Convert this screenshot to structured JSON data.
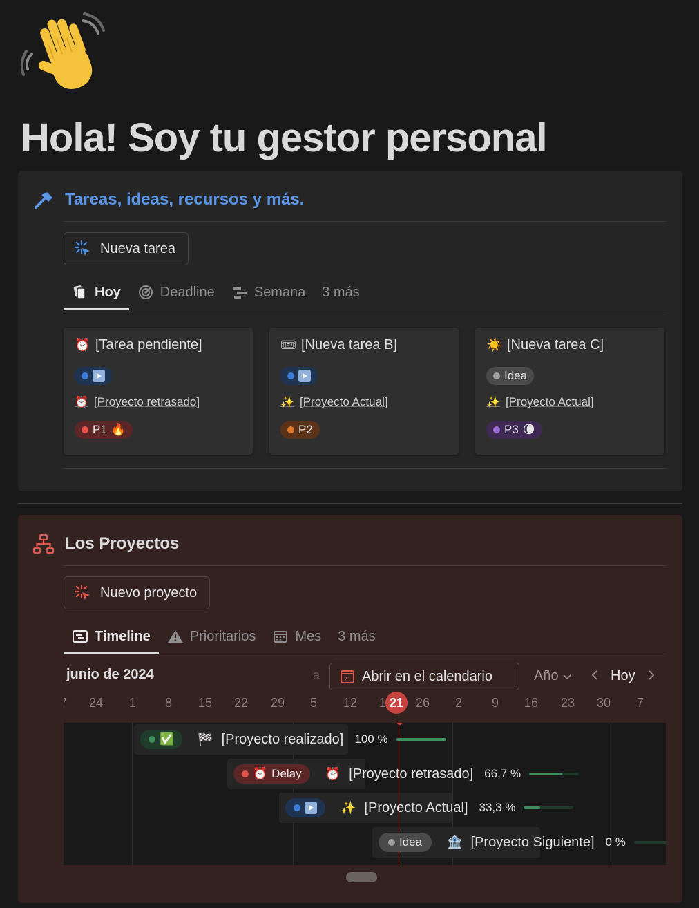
{
  "page": {
    "title": "Hola! Soy tu gestor personal",
    "icon": "waving-hand-icon"
  },
  "tasks_section": {
    "title": "Tareas, ideas, recursos y más.",
    "icon": "hammer-icon",
    "new_button": "Nueva tarea",
    "tabs": [
      {
        "label": "Hoy",
        "icon": "cards-icon",
        "active": true
      },
      {
        "label": "Deadline",
        "icon": "target-icon",
        "active": false
      },
      {
        "label": "Semana",
        "icon": "timeline-icon",
        "active": false
      },
      {
        "label": "3 más",
        "icon": "",
        "active": false
      }
    ],
    "cards": [
      {
        "title": "[Tarea pendiente]",
        "emoji": "⏰",
        "status_color": "#3b7dd8",
        "status_label": "▶",
        "project": "[Proyecto retrasado]",
        "project_emoji": "⏰",
        "priority": "P1",
        "priority_emoji": "🔥",
        "priority_bg": "#5b2625",
        "priority_dot": "#e5534b"
      },
      {
        "title": "[Nueva tarea B]",
        "emoji": "🎟",
        "status_color": "#3b7dd8",
        "status_label": "▶",
        "project": "[Proyecto Actual]",
        "project_emoji": "✨",
        "priority": "P2",
        "priority_emoji": "",
        "priority_bg": "#5c3318",
        "priority_dot": "#e07a2e"
      },
      {
        "title": "[Nueva tarea C]",
        "emoji": "☀️",
        "status_color": "#8e8e8e",
        "status_label": "Idea",
        "project": "[Proyecto Actual]",
        "project_emoji": "✨",
        "priority": "P3",
        "priority_emoji": "🌘",
        "priority_bg": "#3e2a55",
        "priority_dot": "#9b6bd6"
      }
    ]
  },
  "projects_section": {
    "title": "Los Proyectos",
    "icon": "sitemap-icon",
    "new_button": "Nuevo proyecto",
    "tabs": [
      {
        "label": "Timeline",
        "icon": "timeline-icon",
        "active": true
      },
      {
        "label": "Prioritarios",
        "icon": "warning-icon",
        "active": false
      },
      {
        "label": "Mes",
        "icon": "calendar-icon",
        "active": false
      },
      {
        "label": "3 más",
        "icon": "",
        "active": false
      }
    ],
    "timeline": {
      "month": "junio de 2024",
      "a_label": "a",
      "calendar_button": "Abrir en el calendario",
      "scale": "Año",
      "today_button": "Hoy",
      "ticks": [
        "24",
        "1",
        "8",
        "15",
        "22",
        "29",
        "5",
        "12",
        "1",
        "21",
        "26",
        "2",
        "9",
        "16",
        "23",
        "30",
        "7"
      ],
      "today_tick": "21",
      "items": [
        {
          "status_label": "✅",
          "status_dot": "#3e8e5e",
          "status_bg": "#1f3d2a",
          "emoji": "🏁",
          "name": "[Proyecto realizado]",
          "pct_label": "100 %",
          "progress": 1.0
        },
        {
          "status_label": "Delay",
          "status_emoji": "⏰",
          "status_dot": "#e5534b",
          "status_bg": "#5b2625",
          "emoji": "⏰",
          "name": "[Proyecto retrasado]",
          "pct_label": "66,7 %",
          "progress": 0.667
        },
        {
          "status_label": "▶",
          "status_dot": "#3b7dd8",
          "status_bg": "#1f3452",
          "emoji": "✨",
          "name": "[Proyecto Actual]",
          "pct_label": "33,3 %",
          "progress": 0.333
        },
        {
          "status_label": "Idea",
          "status_dot": "#a0a0a0",
          "status_bg": "#4a4a4a",
          "emoji": "🏦",
          "name": "[Proyecto Siguiente]",
          "pct_label": "0 %",
          "progress": 0.0
        }
      ]
    }
  }
}
